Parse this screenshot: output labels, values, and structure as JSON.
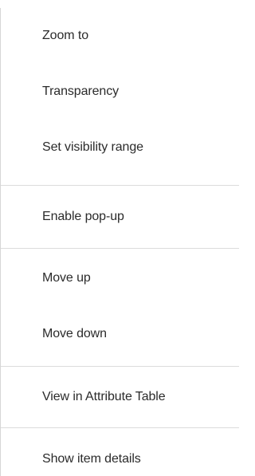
{
  "menu": {
    "groups": [
      {
        "items": [
          {
            "label": "Zoom to"
          },
          {
            "label": "Transparency"
          },
          {
            "label": "Set visibility range"
          }
        ]
      },
      {
        "items": [
          {
            "label": "Enable pop-up"
          }
        ]
      },
      {
        "items": [
          {
            "label": "Move up"
          },
          {
            "label": "Move down"
          }
        ]
      },
      {
        "items": [
          {
            "label": "View in Attribute Table"
          }
        ]
      },
      {
        "items": [
          {
            "label": "Show item details"
          }
        ]
      }
    ]
  }
}
